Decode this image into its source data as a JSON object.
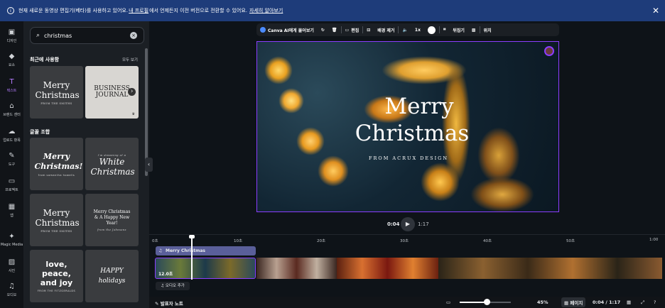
{
  "banner": {
    "text_before": "현재 새로운 동영상 편집기(베타)를 사용하고 있어요.",
    "link_settings": "내 프로필",
    "text_middle": "에서 언제든지 이전 버전으로 전환할 수 있어요.",
    "link_learn": "자세히 알아보기",
    "info_icon": "i",
    "close_icon": "✕"
  },
  "rail": [
    {
      "label": "디자인",
      "icon": "▣"
    },
    {
      "label": "요소",
      "icon": "◆"
    },
    {
      "label": "텍스트",
      "icon": "T"
    },
    {
      "label": "브랜드 센터",
      "icon": "⌂"
    },
    {
      "label": "업로드 항목",
      "icon": "☁"
    },
    {
      "label": "도구",
      "icon": "✎"
    },
    {
      "label": "프로젝트",
      "icon": "▭"
    },
    {
      "label": "앱",
      "icon": "▦"
    },
    {
      "label": "Magic Media",
      "icon": "✦"
    },
    {
      "label": "사진",
      "icon": "▨"
    },
    {
      "label": "오디오",
      "icon": "♫"
    }
  ],
  "panel": {
    "search_value": "christmas",
    "recent_title": "최근에 사용함",
    "see_all": "모두 보기",
    "combo_title": "글꼴 조합",
    "recent_tiles": [
      {
        "big": "Merry Christmas",
        "small": "FROM THE SMITHS"
      },
      {
        "big": "BUSINESS JOURNAL",
        "small": ""
      }
    ],
    "combo_tiles": [
      {
        "big": "Merry Christmas!",
        "small": "from samantha howells"
      },
      {
        "big": "White Christmas",
        "small": "I'm dreaming of a"
      },
      {
        "big": "Merry Christmas",
        "small": "FROM THE SMITHS"
      },
      {
        "big": "Merry Christmas & A Happy New Year!",
        "small": "from the Johnsons"
      },
      {
        "big": "love, peace, and joy",
        "small": "FROM THE FITZGERALDS"
      },
      {
        "big": "HAPPY holidays",
        "small": ""
      }
    ]
  },
  "toolbar": {
    "ai_label": "Canva AI에게 물어보기",
    "edit_label": "편집",
    "bg_remove_label": "배경 제거",
    "speed_label": "1x",
    "flip_label": "뒤집기",
    "position_label": "위치"
  },
  "canvas": {
    "title_line1": "Merry",
    "title_line2": "Christmas",
    "subtitle": "FROM ACRUX DESIGN"
  },
  "player": {
    "current": "0:04",
    "total": "1:17"
  },
  "timeline": {
    "ticks": [
      "0초",
      "10초",
      "20초",
      "30초",
      "40초",
      "50초",
      "1:00"
    ],
    "audio_track_label": "Merry Christmas",
    "clip_duration": "12.0초",
    "add_audio": "오디오 추가"
  },
  "footer": {
    "notes": "발표자 노트",
    "zoom": "45%",
    "page_label": "페이지",
    "time": "0:04 / 1:17"
  }
}
